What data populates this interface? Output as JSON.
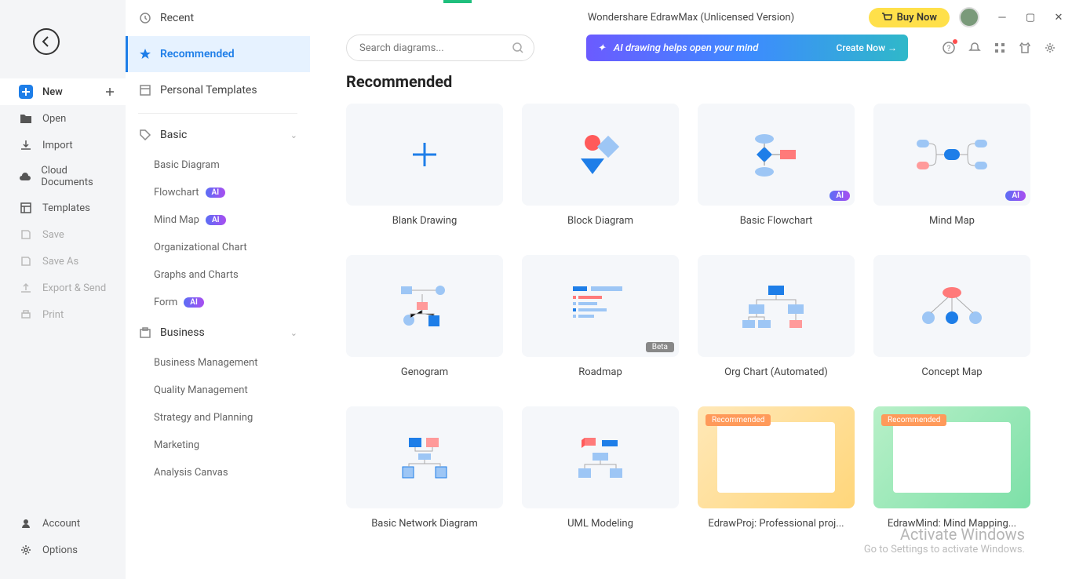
{
  "app": {
    "title": "Wondershare EdrawMax (Unlicensed Version)",
    "buy_label": "Buy Now"
  },
  "sidebar1": {
    "items": [
      {
        "label": "New",
        "icon": "plus"
      },
      {
        "label": "Open",
        "icon": "folder"
      },
      {
        "label": "Import",
        "icon": "import"
      },
      {
        "label": "Cloud Documents",
        "icon": "cloud"
      },
      {
        "label": "Templates",
        "icon": "templates"
      },
      {
        "label": "Save",
        "icon": "save"
      },
      {
        "label": "Save As",
        "icon": "saveas"
      },
      {
        "label": "Export & Send",
        "icon": "export"
      },
      {
        "label": "Print",
        "icon": "print"
      }
    ],
    "bottom": [
      {
        "label": "Account",
        "icon": "account"
      },
      {
        "label": "Options",
        "icon": "gear"
      }
    ]
  },
  "sidebar2": {
    "top": [
      {
        "label": "Recent"
      },
      {
        "label": "Recommended"
      },
      {
        "label": "Personal Templates"
      }
    ],
    "groups": [
      {
        "label": "Basic",
        "items": [
          {
            "label": "Basic Diagram"
          },
          {
            "label": "Flowchart",
            "ai": true
          },
          {
            "label": "Mind Map",
            "ai": true
          },
          {
            "label": "Organizational Chart"
          },
          {
            "label": "Graphs and Charts"
          },
          {
            "label": "Form",
            "ai": true
          }
        ]
      },
      {
        "label": "Business",
        "items": [
          {
            "label": "Business Management"
          },
          {
            "label": "Quality Management"
          },
          {
            "label": "Strategy and Planning"
          },
          {
            "label": "Marketing"
          },
          {
            "label": "Analysis Canvas"
          }
        ]
      }
    ]
  },
  "search": {
    "placeholder": "Search diagrams..."
  },
  "banner": {
    "text": "AI drawing helps open your mind",
    "cta": "Create Now →"
  },
  "section": {
    "title": "Recommended"
  },
  "cards": [
    {
      "label": "Blank Drawing"
    },
    {
      "label": "Block Diagram"
    },
    {
      "label": "Basic Flowchart",
      "badge": "AI"
    },
    {
      "label": "Mind Map",
      "badge": "AI"
    },
    {
      "label": "Genogram"
    },
    {
      "label": "Roadmap",
      "badge": "Beta"
    },
    {
      "label": "Org Chart (Automated)"
    },
    {
      "label": "Concept Map"
    },
    {
      "label": "Basic Network Diagram"
    },
    {
      "label": "UML Modeling"
    },
    {
      "label": "EdrawProj: Professional proj...",
      "badge": "Recommended"
    },
    {
      "label": "EdrawMind: Mind Mapping...",
      "badge": "Recommended"
    }
  ],
  "badges": {
    "ai": "AI",
    "beta": "Beta",
    "recommended": "Recommended"
  },
  "watermark": {
    "line1": "Activate Windows",
    "line2": "Go to Settings to activate Windows."
  }
}
